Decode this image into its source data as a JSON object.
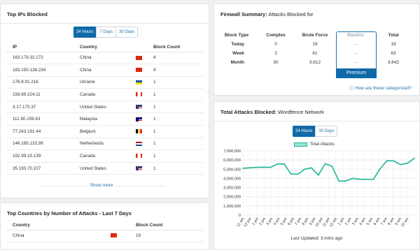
{
  "top_ips": {
    "title": "Top IPs Blocked",
    "tabs": [
      "24 Hours",
      "7 Days",
      "30 Days"
    ],
    "columns": [
      "IP",
      "Country",
      "Block Count"
    ],
    "rows": [
      {
        "ip": "163.179.32.172",
        "country": "China",
        "flag": "cn-flag-icon",
        "count": "4"
      },
      {
        "ip": "183.150.138.234",
        "country": "China",
        "flag": "cn-flag-icon",
        "count": "4"
      },
      {
        "ip": "176.8.91.216",
        "country": "Ukraine",
        "flag": "ua-flag-icon",
        "count": "1"
      },
      {
        "ip": "158.69.224.11",
        "country": "Canada",
        "flag": "ca-flag-icon",
        "count": "1"
      },
      {
        "ip": "3.17.175.37",
        "country": "United States",
        "flag": "us-flag-icon",
        "count": "1"
      },
      {
        "ip": "111.90.159.43",
        "country": "Malaysia",
        "flag": "my-flag-icon",
        "count": "1"
      },
      {
        "ip": "77.243.191.44",
        "country": "Belgium",
        "flag": "be-flag-icon",
        "count": "1"
      },
      {
        "ip": "146.185.133.99",
        "country": "Netherlands",
        "flag": "nl-flag-icon",
        "count": "1"
      },
      {
        "ip": "192.99.15.139",
        "country": "Canada",
        "flag": "ca-flag-icon",
        "count": "1"
      },
      {
        "ip": "35.193.70.227",
        "country": "United States",
        "flag": "us-flag-icon",
        "count": "1"
      }
    ],
    "show_more": "Show more"
  },
  "firewall": {
    "title_bold": "Firewall Summary:",
    "title_rest": "Attacks Blocked for",
    "columns": [
      "Block Type",
      "Complex",
      "Brute Force",
      "Blacklist",
      "Total"
    ],
    "rows": [
      {
        "label": "Today",
        "complex": "0",
        "brute": "19",
        "blacklist": "—",
        "total": "19"
      },
      {
        "label": "Week",
        "complex": "2",
        "brute": "61",
        "blacklist": "—",
        "total": "63"
      },
      {
        "label": "Month",
        "complex": "30",
        "brute": "3,612",
        "blacklist": "—",
        "total": "3,642"
      }
    ],
    "premium_label": "Premium",
    "categorized_link": "How are these categorized?"
  },
  "total_attacks": {
    "title_bold": "Total Attacks Blocked:",
    "title_rest": "Wordfence Network",
    "tabs": [
      "24 Hours",
      "30 Days"
    ],
    "last_updated": "Last Updated: 3 mins ago"
  },
  "chart_data": {
    "type": "line",
    "series": [
      {
        "name": "Total Attacks",
        "values": [
          5100000,
          5150000,
          5200000,
          5220000,
          5200000,
          5550000,
          5580000,
          4480000,
          4450000,
          5000000,
          5150000,
          4350000,
          5600000,
          5300000,
          3700000,
          3720000,
          4000000,
          3900000,
          3880000,
          3880000,
          5050000,
          5920000,
          5900000,
          5500000,
          5650000,
          6200000
        ]
      }
    ],
    "categories": [
      "11 am",
      "12 pm",
      "1 pm",
      "2 pm",
      "3 pm",
      "4 pm",
      "5 pm",
      "6 pm",
      "7 pm",
      "8 pm",
      "9 pm",
      "10 pm",
      "11 pm",
      "12 am",
      "1 am",
      "2 am",
      "3 am",
      "4 am",
      "5 am",
      "6 am",
      "7 am",
      "8 am",
      "9 am",
      "10 am"
    ],
    "yticks": [
      "7,000,000",
      "6,000,000",
      "5,000,000",
      "4,000,000",
      "3,000,000",
      "2,000,000",
      "1,000,000",
      "0"
    ],
    "ylim": [
      0,
      7000000
    ],
    "color": "#1fb595",
    "grid": true,
    "legend": "top-center"
  },
  "top_countries": {
    "title": "Top Countries by Number of Attacks - Last 7 Days",
    "columns": [
      "Country",
      "Block Count"
    ],
    "rows": [
      {
        "country": "China",
        "flag": "cn-flag-icon",
        "count": "19"
      }
    ]
  }
}
